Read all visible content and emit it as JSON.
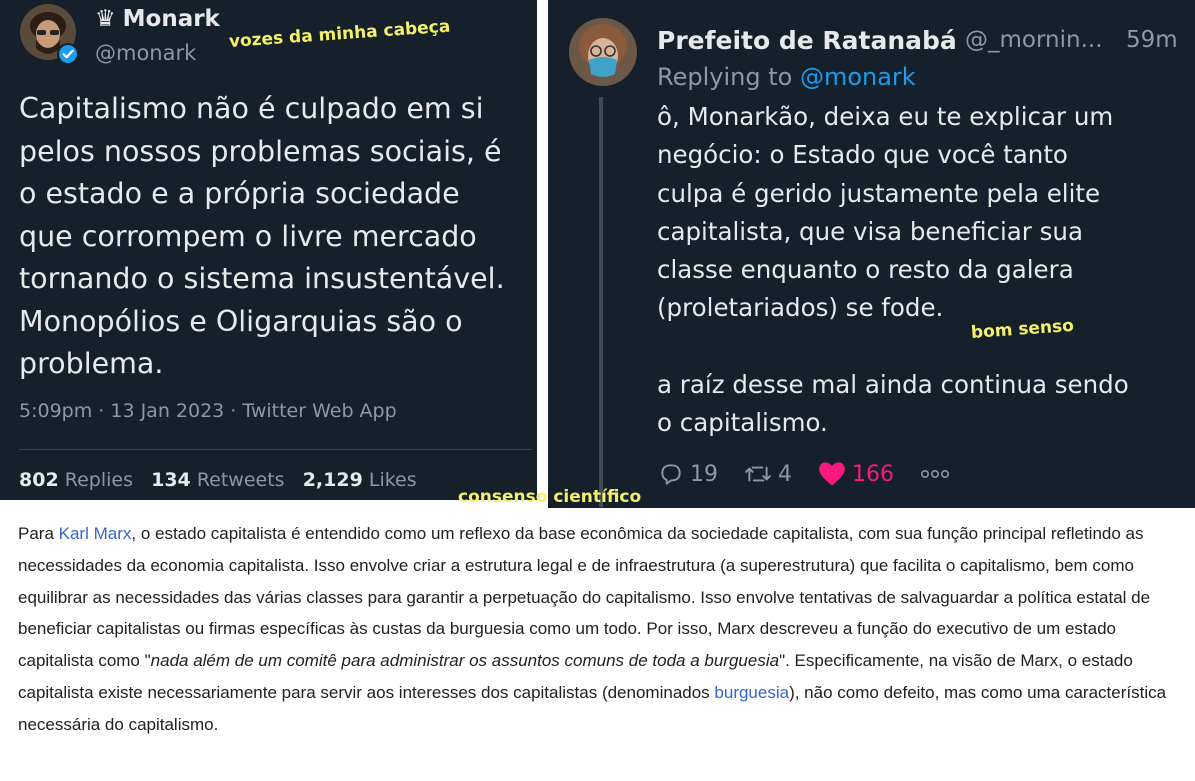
{
  "left_tweet": {
    "crown": "♛",
    "name": "Monark",
    "handle": "@monark",
    "text": "Capitalismo não é culpado em si\npelos nossos problemas sociais, é\no estado e a própria sociedade\nque corrompem o livre mercado\ntornando o sistema insustentável.\nMonopólios e Oligarquias são o\nproblema.",
    "meta": "5:09pm · 13 Jan 2023 · Twitter Web App",
    "stats": {
      "replies_count": "802",
      "replies_label": "Replies",
      "retweets_count": "134",
      "retweets_label": "Retweets",
      "likes_count": "2,129",
      "likes_label": "Likes"
    }
  },
  "right_tweet": {
    "name": "Prefeito de Ratanabá",
    "handle": "@_mornin...",
    "time": "59m",
    "replying_prefix": "Replying to",
    "replying_to": "@monark",
    "text": "ô, Monarkão, deixa eu te explicar um\nnegócio: o Estado que você tanto\nculpa é gerido justamente pela elite\ncapitalista, que visa beneficiar sua\nclasse enquanto o resto da galera\n(proletariados) se fode.\n\na raíz desse mal ainda continua sendo\no capitalismo.",
    "actions": {
      "replies": "19",
      "retweets": "4",
      "likes": "166"
    }
  },
  "overlays": {
    "voices": "vozes da minha cabeça",
    "common_sense": "bom senso",
    "consensus": "consenso científico"
  },
  "wiki": {
    "p1": "Para ",
    "link_marx": "Karl Marx",
    "p2": ", o estado capitalista é entendido como um reflexo da base econômica da sociedade capitalista, com sua função principal refletindo as necessidades da economia capitalista. Isso envolve criar a estrutura legal e de infraestrutura (a superestrutura) que facilita o capitalismo, bem como equilibrar as necessidades das várias classes para garantir a perpetuação do capitalismo. Isso envolve tentativas de salvaguardar a política estatal de beneficiar capitalistas ou firmas específicas às custas da burguesia como um todo. Por isso, Marx descreveu a função do executivo de um estado capitalista como \"",
    "quote": "nada além de um comitê para administrar os assuntos comuns de toda a burguesia",
    "p3": "\". Especificamente, na visão de Marx, o estado capitalista existe necessariamente para servir aos interesses dos capitalistas (denominados ",
    "link_burguesia": "burguesia",
    "p4": "), não como defeito, mas como uma característica necessária do capitalismo."
  },
  "colors": {
    "tweet_bg": "#15202b",
    "text_primary": "#e7e9ea",
    "text_secondary": "#8b98a5",
    "twitter_blue": "#1d9bf0",
    "like_pink": "#f91880",
    "overlay_yellow": "#f4f06a",
    "wiki_link": "#3366cc"
  }
}
